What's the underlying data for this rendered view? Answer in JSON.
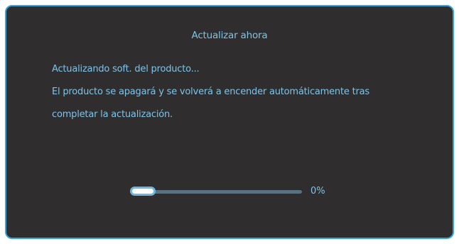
{
  "dialog": {
    "title": "Actualizar ahora",
    "status_line": "Actualizando soft. del producto...",
    "info_line_1": "El producto se apagará y se volverá a encender automáticamente tras",
    "info_line_2": "completar la actualización."
  },
  "progress": {
    "value_fraction": 0.0,
    "label": "0%"
  },
  "colors": {
    "background": "#2f2d2d",
    "border": "#31a8e0",
    "text": "#7fc4e8",
    "track": "#5a7180",
    "knob": "#ffffff"
  }
}
